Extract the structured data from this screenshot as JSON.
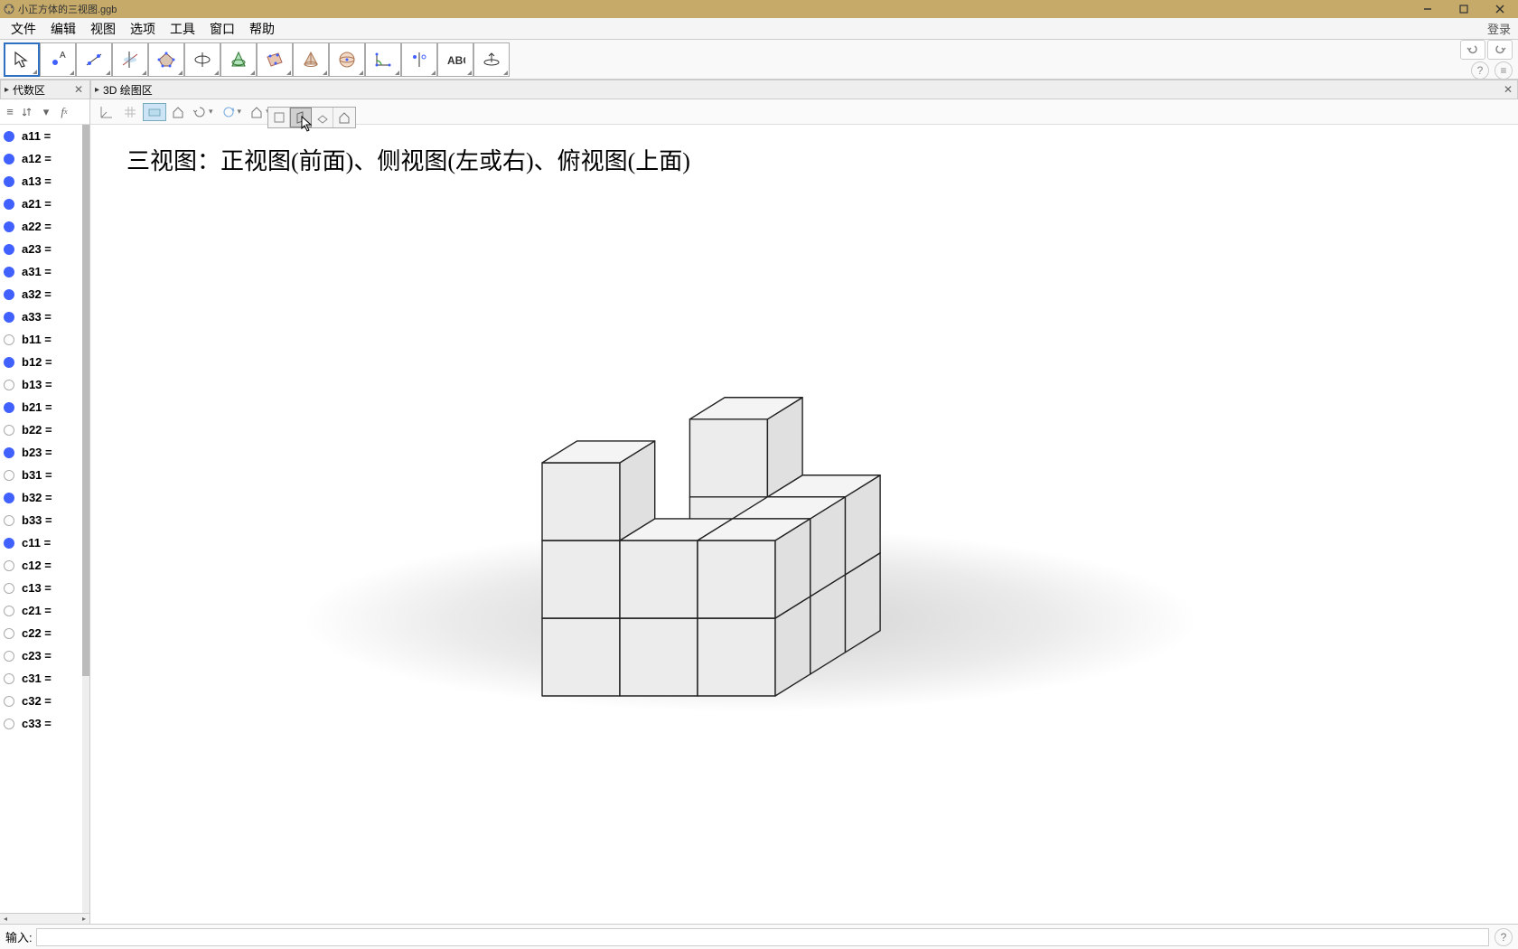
{
  "titlebar": {
    "filename": "小正方体的三视图.ggb"
  },
  "menubar": {
    "items": [
      "文件",
      "编辑",
      "视图",
      "选项",
      "工具",
      "窗口",
      "帮助"
    ],
    "login": "登录"
  },
  "panels": {
    "algebra_title": "代数区",
    "view3d_title": "3D 绘图区"
  },
  "algebra": {
    "items": [
      {
        "name": "a11 =",
        "blue": true
      },
      {
        "name": "a12 =",
        "blue": true
      },
      {
        "name": "a13 =",
        "blue": true
      },
      {
        "name": "a21 =",
        "blue": true
      },
      {
        "name": "a22 =",
        "blue": true
      },
      {
        "name": "a23 =",
        "blue": true
      },
      {
        "name": "a31 =",
        "blue": true
      },
      {
        "name": "a32 =",
        "blue": true
      },
      {
        "name": "a33 =",
        "blue": true
      },
      {
        "name": "b11 =",
        "blue": false
      },
      {
        "name": "b12 =",
        "blue": true
      },
      {
        "name": "b13 =",
        "blue": false
      },
      {
        "name": "b21 =",
        "blue": true
      },
      {
        "name": "b22 =",
        "blue": false
      },
      {
        "name": "b23 =",
        "blue": true
      },
      {
        "name": "b31 =",
        "blue": false
      },
      {
        "name": "b32 =",
        "blue": true
      },
      {
        "name": "b33 =",
        "blue": false
      },
      {
        "name": "c11 =",
        "blue": true
      },
      {
        "name": "c12 =",
        "blue": false
      },
      {
        "name": "c13 =",
        "blue": false
      },
      {
        "name": "c21 =",
        "blue": false
      },
      {
        "name": "c22 =",
        "blue": false
      },
      {
        "name": "c23 =",
        "blue": false
      },
      {
        "name": "c31 =",
        "blue": false
      },
      {
        "name": "c32 =",
        "blue": false
      },
      {
        "name": "c33 =",
        "blue": false
      }
    ]
  },
  "canvas": {
    "text": "三视图：正视图(前面)、侧视图(左或右)、俯视图(上面)"
  },
  "inputbar": {
    "label": "输入:"
  },
  "cubes": {
    "comment": "grid positions i=left-right(0..2), j=front-back(0..2), k=bottom-top(0..2); true=present",
    "layer0": [
      [
        1,
        1,
        1
      ],
      [
        1,
        1,
        1
      ],
      [
        1,
        1,
        1
      ]
    ],
    "layer1": [
      [
        1,
        1,
        1
      ],
      [
        0,
        0,
        1
      ],
      [
        0,
        1,
        1
      ]
    ],
    "layer2": [
      [
        1,
        0,
        0
      ],
      [
        0,
        0,
        0
      ],
      [
        0,
        1,
        0
      ]
    ]
  }
}
